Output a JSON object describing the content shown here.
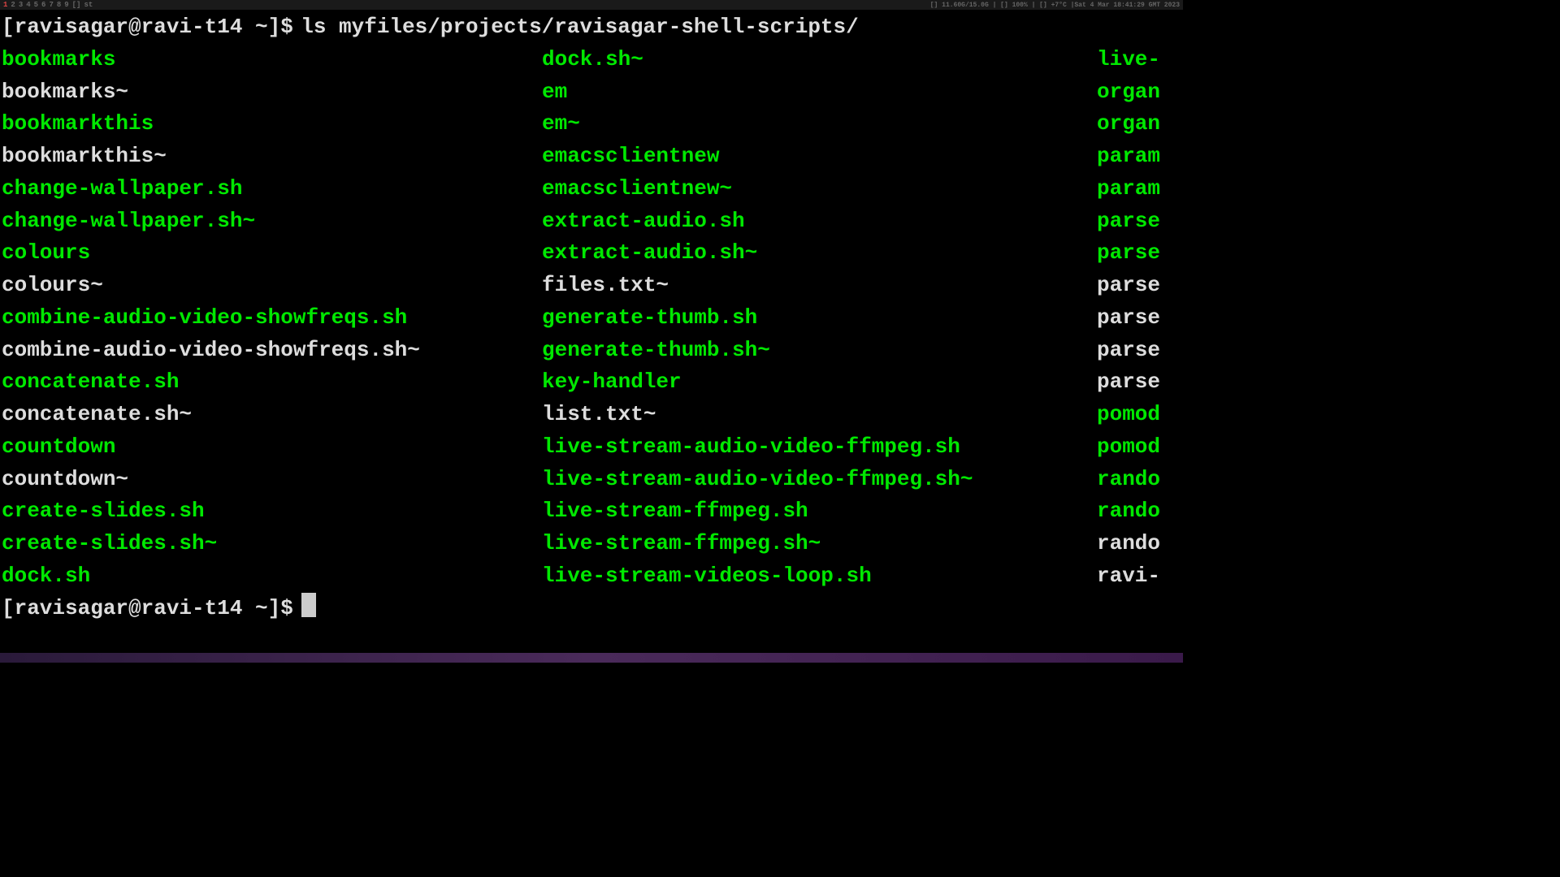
{
  "topbar": {
    "workspaces": [
      "1",
      "2",
      "3",
      "4",
      "5",
      "6",
      "7",
      "8",
      "9",
      "[]"
    ],
    "active": 0,
    "title": "st",
    "status": "[] 11.60G/15.0G | [] 100% | [] +7°C |Sat  4 Mar 18:41:29 GMT 2023"
  },
  "terminal": {
    "prompt1": "[ravisagar@ravi-t14 ~]$",
    "command1": "ls myfiles/projects/ravisagar-shell-scripts/",
    "prompt2": "[ravisagar@ravi-t14 ~]$",
    "columns": [
      [
        {
          "n": "bookmarks",
          "x": true
        },
        {
          "n": "bookmarks~",
          "x": false
        },
        {
          "n": "bookmarkthis",
          "x": true
        },
        {
          "n": "bookmarkthis~",
          "x": false
        },
        {
          "n": "change-wallpaper.sh",
          "x": true
        },
        {
          "n": "change-wallpaper.sh~",
          "x": true
        },
        {
          "n": "colours",
          "x": true
        },
        {
          "n": "colours~",
          "x": false
        },
        {
          "n": "combine-audio-video-showfreqs.sh",
          "x": true
        },
        {
          "n": "combine-audio-video-showfreqs.sh~",
          "x": false
        },
        {
          "n": "concatenate.sh",
          "x": true
        },
        {
          "n": "concatenate.sh~",
          "x": false
        },
        {
          "n": "countdown",
          "x": true
        },
        {
          "n": "countdown~",
          "x": false
        },
        {
          "n": "create-slides.sh",
          "x": true
        },
        {
          "n": "create-slides.sh~",
          "x": true
        },
        {
          "n": "dock.sh",
          "x": true
        }
      ],
      [
        {
          "n": "dock.sh~",
          "x": true
        },
        {
          "n": "em",
          "x": true
        },
        {
          "n": "em~",
          "x": true
        },
        {
          "n": "emacsclientnew",
          "x": true
        },
        {
          "n": "emacsclientnew~",
          "x": true
        },
        {
          "n": "extract-audio.sh",
          "x": true
        },
        {
          "n": "extract-audio.sh~",
          "x": true
        },
        {
          "n": "files.txt~",
          "x": false
        },
        {
          "n": "generate-thumb.sh",
          "x": true
        },
        {
          "n": "generate-thumb.sh~",
          "x": true
        },
        {
          "n": "key-handler",
          "x": true
        },
        {
          "n": "list.txt~",
          "x": false
        },
        {
          "n": "live-stream-audio-video-ffmpeg.sh",
          "x": true
        },
        {
          "n": "live-stream-audio-video-ffmpeg.sh~",
          "x": true
        },
        {
          "n": "live-stream-ffmpeg.sh",
          "x": true
        },
        {
          "n": "live-stream-ffmpeg.sh~",
          "x": true
        },
        {
          "n": "live-stream-videos-loop.sh",
          "x": true
        }
      ],
      [
        {
          "n": "live-",
          "x": true
        },
        {
          "n": "organ",
          "x": true
        },
        {
          "n": "organ",
          "x": true
        },
        {
          "n": "param",
          "x": true
        },
        {
          "n": "param",
          "x": true
        },
        {
          "n": "parse",
          "x": true
        },
        {
          "n": "parse",
          "x": true
        },
        {
          "n": "parse",
          "x": false
        },
        {
          "n": "parse",
          "x": false
        },
        {
          "n": "parse",
          "x": false
        },
        {
          "n": "parse",
          "x": false
        },
        {
          "n": "pomod",
          "x": true
        },
        {
          "n": "pomod",
          "x": true
        },
        {
          "n": "rando",
          "x": true
        },
        {
          "n": "rando",
          "x": true
        },
        {
          "n": "rando",
          "x": false
        },
        {
          "n": "ravi-",
          "x": false
        }
      ]
    ]
  }
}
